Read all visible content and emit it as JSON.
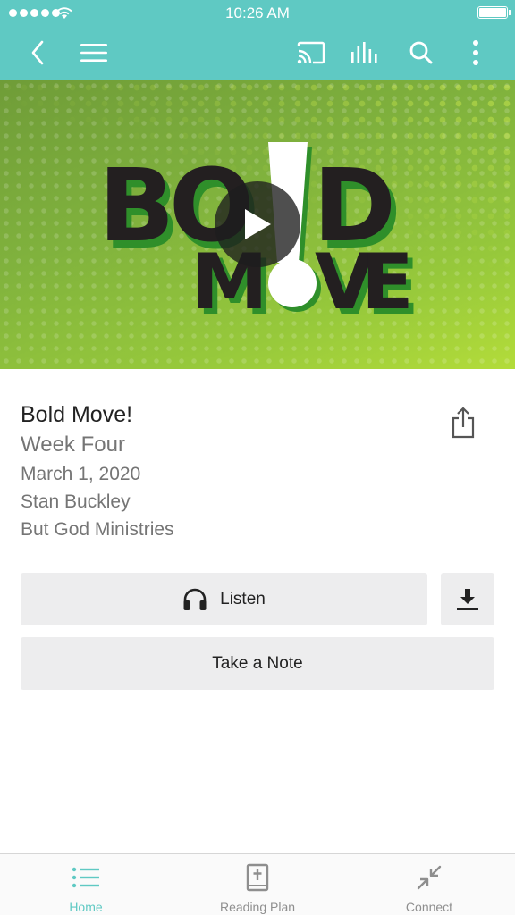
{
  "status_bar": {
    "time": "10:26 AM"
  },
  "nav": {
    "back_icon": "chevron-left-icon",
    "menu_icon": "hamburger-menu-icon",
    "cast_icon": "cast-icon",
    "audio_icon": "audio-bars-icon",
    "search_icon": "search-icon",
    "more_icon": "more-vertical-icon"
  },
  "hero": {
    "art_line1": [
      "B",
      "O",
      "L",
      "D"
    ],
    "art_line2": [
      "M",
      "O",
      "V",
      "E"
    ],
    "play_icon": "play-icon",
    "colors": {
      "background": "#8cbe3c",
      "text": "#231f20",
      "shadow": "#2f8f2a",
      "accent": "#ffffff"
    }
  },
  "message": {
    "title": "Bold Move!",
    "series": "Week Four",
    "date": "March 1, 2020",
    "speaker": "Stan Buckley",
    "ministry": "But God Ministries",
    "share_icon": "share-icon"
  },
  "actions": {
    "listen_label": "Listen",
    "listen_icon": "headphones-icon",
    "download_icon": "download-icon",
    "note_label": "Take a Note"
  },
  "tabs": [
    {
      "label": "Home",
      "icon": "list-icon",
      "active": true
    },
    {
      "label": "Reading Plan",
      "icon": "bible-icon",
      "active": false
    },
    {
      "label": "Connect",
      "icon": "connect-arrows-icon",
      "active": false
    }
  ],
  "colors": {
    "accent": "#5fc9c3",
    "button_bg": "#ededee",
    "muted_text": "#757575"
  }
}
